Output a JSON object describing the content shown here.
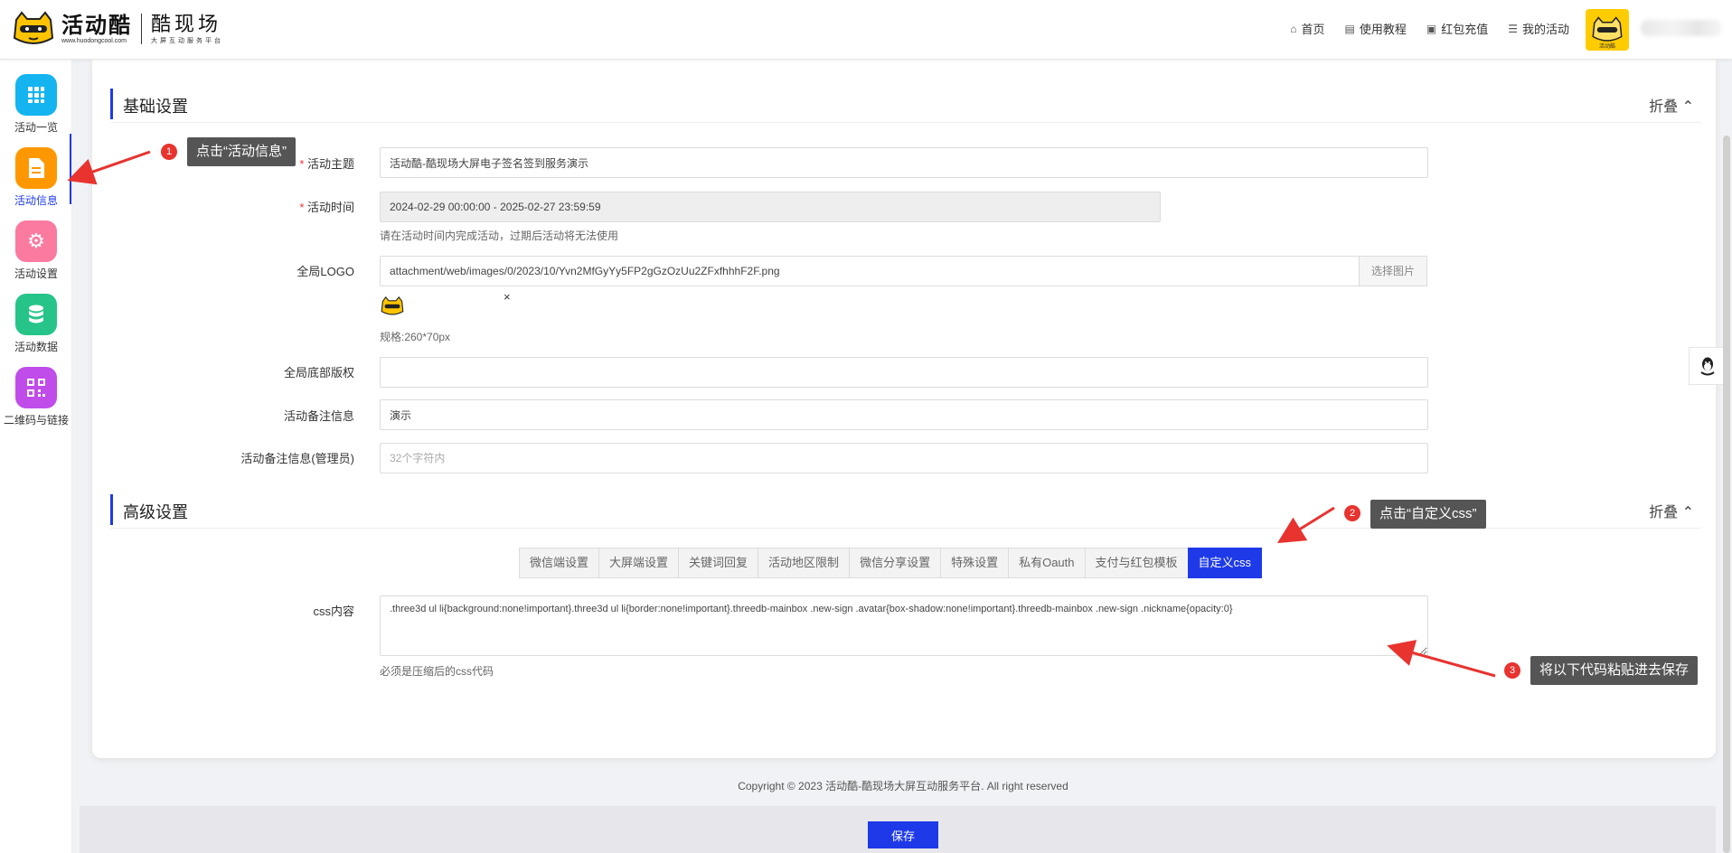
{
  "brand": {
    "name": "活动酷",
    "url": "www.huodongcool.com",
    "sub_name": "酷现场",
    "sub_tagline": "大屏互动服务平台"
  },
  "nav": [
    {
      "label": "首页",
      "icon": "home-icon"
    },
    {
      "label": "使用教程",
      "icon": "doc-icon"
    },
    {
      "label": "红包充值",
      "icon": "redpacket-icon"
    },
    {
      "label": "我的活动",
      "icon": "list-icon"
    }
  ],
  "user": {
    "avatar_label": "活动酷"
  },
  "sidebar": [
    {
      "label": "活动一览",
      "icon": "grid-icon",
      "color": "#14b4f0"
    },
    {
      "label": "活动信息",
      "icon": "document-icon",
      "color": "#ff9800",
      "active": true
    },
    {
      "label": "活动设置",
      "icon": "gear-icon",
      "color": "#fb7aa0"
    },
    {
      "label": "活动数据",
      "icon": "database-icon",
      "color": "#27c48a"
    },
    {
      "label": "二维码与链接",
      "icon": "qrcode-icon",
      "color": "#c04dea"
    }
  ],
  "basic": {
    "title": "基础设置",
    "fold": "折叠",
    "theme_label": "活动主题",
    "theme_value": "活动酷-酷现场大屏电子签名签到服务演示",
    "time_label": "活动时间",
    "time_value": "2024-02-29 00:00:00 - 2025-02-27 23:59:59",
    "time_hint": "请在活动时间内完成活动，过期后活动将无法使用",
    "logo_label": "全局LOGO",
    "logo_value": "attachment/web/images/0/2023/10/Yvn2MfGyYy5FP2gGzOzUu2ZFxfhhhF2F.png",
    "logo_btn": "选择图片",
    "logo_close": "×",
    "logo_hint": "规格:260*70px",
    "copyright_label": "全局底部版权",
    "copyright_value": "",
    "remark_label": "活动备注信息",
    "remark_value": "演示",
    "admin_remark_label": "活动备注信息(管理员)",
    "admin_remark_placeholder": "32个字符内"
  },
  "advanced": {
    "title": "高级设置",
    "fold": "折叠",
    "tabs": [
      "微信端设置",
      "大屏端设置",
      "关键词回复",
      "活动地区限制",
      "微信分享设置",
      "特殊设置",
      "私有Oauth",
      "支付与红包模板",
      "自定义css"
    ],
    "active_tab": 8,
    "css_label": "css内容",
    "css_value": ".three3d ul li{background:none!important}.three3d ul li{border:none!important}.threedb-mainbox .new-sign .avatar{box-shadow:none!important}.threedb-mainbox .new-sign .nickname{opacity:0}",
    "css_hint": "必须是压缩后的css代码"
  },
  "footer": {
    "copyright": "Copyright © 2023 活动酷-酷现场大屏互动服务平台. All right reserved",
    "save": "保存"
  },
  "annotations": [
    {
      "num": "1",
      "text": "点击“活动信息”"
    },
    {
      "num": "2",
      "text": "点击“自定义css”"
    },
    {
      "num": "3",
      "text": "将以下代码粘贴进去保存"
    }
  ]
}
